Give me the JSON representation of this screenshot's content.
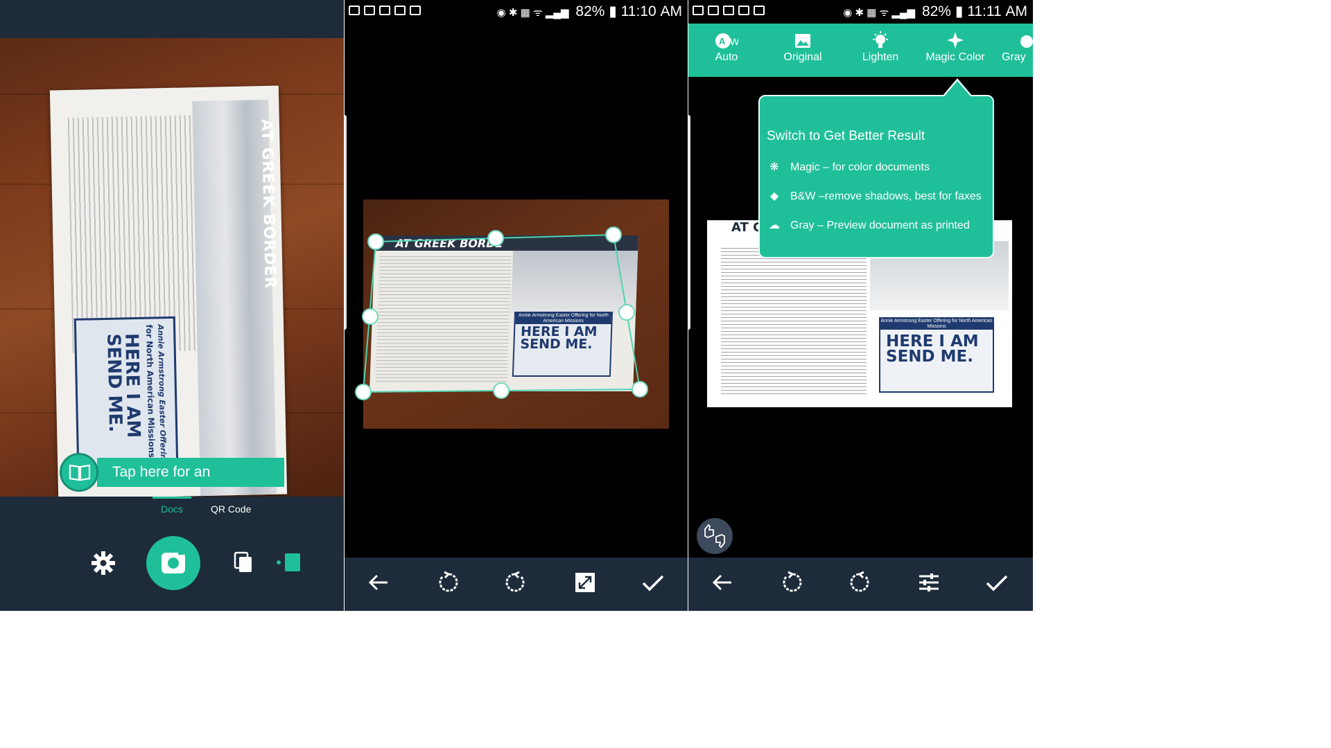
{
  "panel1": {
    "document_headline": "AT GREEK BORDER",
    "ad_line1": "Annie Armstrong Easter Offering",
    "ad_line2": "for North American Missions",
    "ad_big": "HERE I AM SEND ME.",
    "experience_banner": "Tap here for an experience",
    "modes": {
      "docs": "Docs",
      "qr": "QR Code"
    }
  },
  "status_left": {
    "battery": "82%",
    "time": "11:10 AM"
  },
  "status_right": {
    "battery": "82%",
    "time": "11:11 AM"
  },
  "panel2": {
    "document_headline": "AT GREEK BORDE",
    "ad_caption": "Annie Armstrong Easter Offering for North American Missions",
    "ad_big": "HERE I AM SEND ME."
  },
  "panel3": {
    "filters": [
      "Auto",
      "Original",
      "Lighten",
      "Magic Color",
      "Gray"
    ],
    "document_headline": "AT G",
    "ad_caption": "Annie Armstrong Easter Offering for North American Missions",
    "ad_big": "HERE I AM SEND ME.",
    "popup": {
      "title": "Switch to Get Better Result",
      "items": [
        "Magic – for color documents",
        "B&W –remove shadows, best for faxes",
        "Gray – Preview document as printed"
      ]
    }
  },
  "colors": {
    "accent": "#1fbf9a",
    "toolbar": "#1d2b3a",
    "ad_blue": "#1f3a6e"
  }
}
